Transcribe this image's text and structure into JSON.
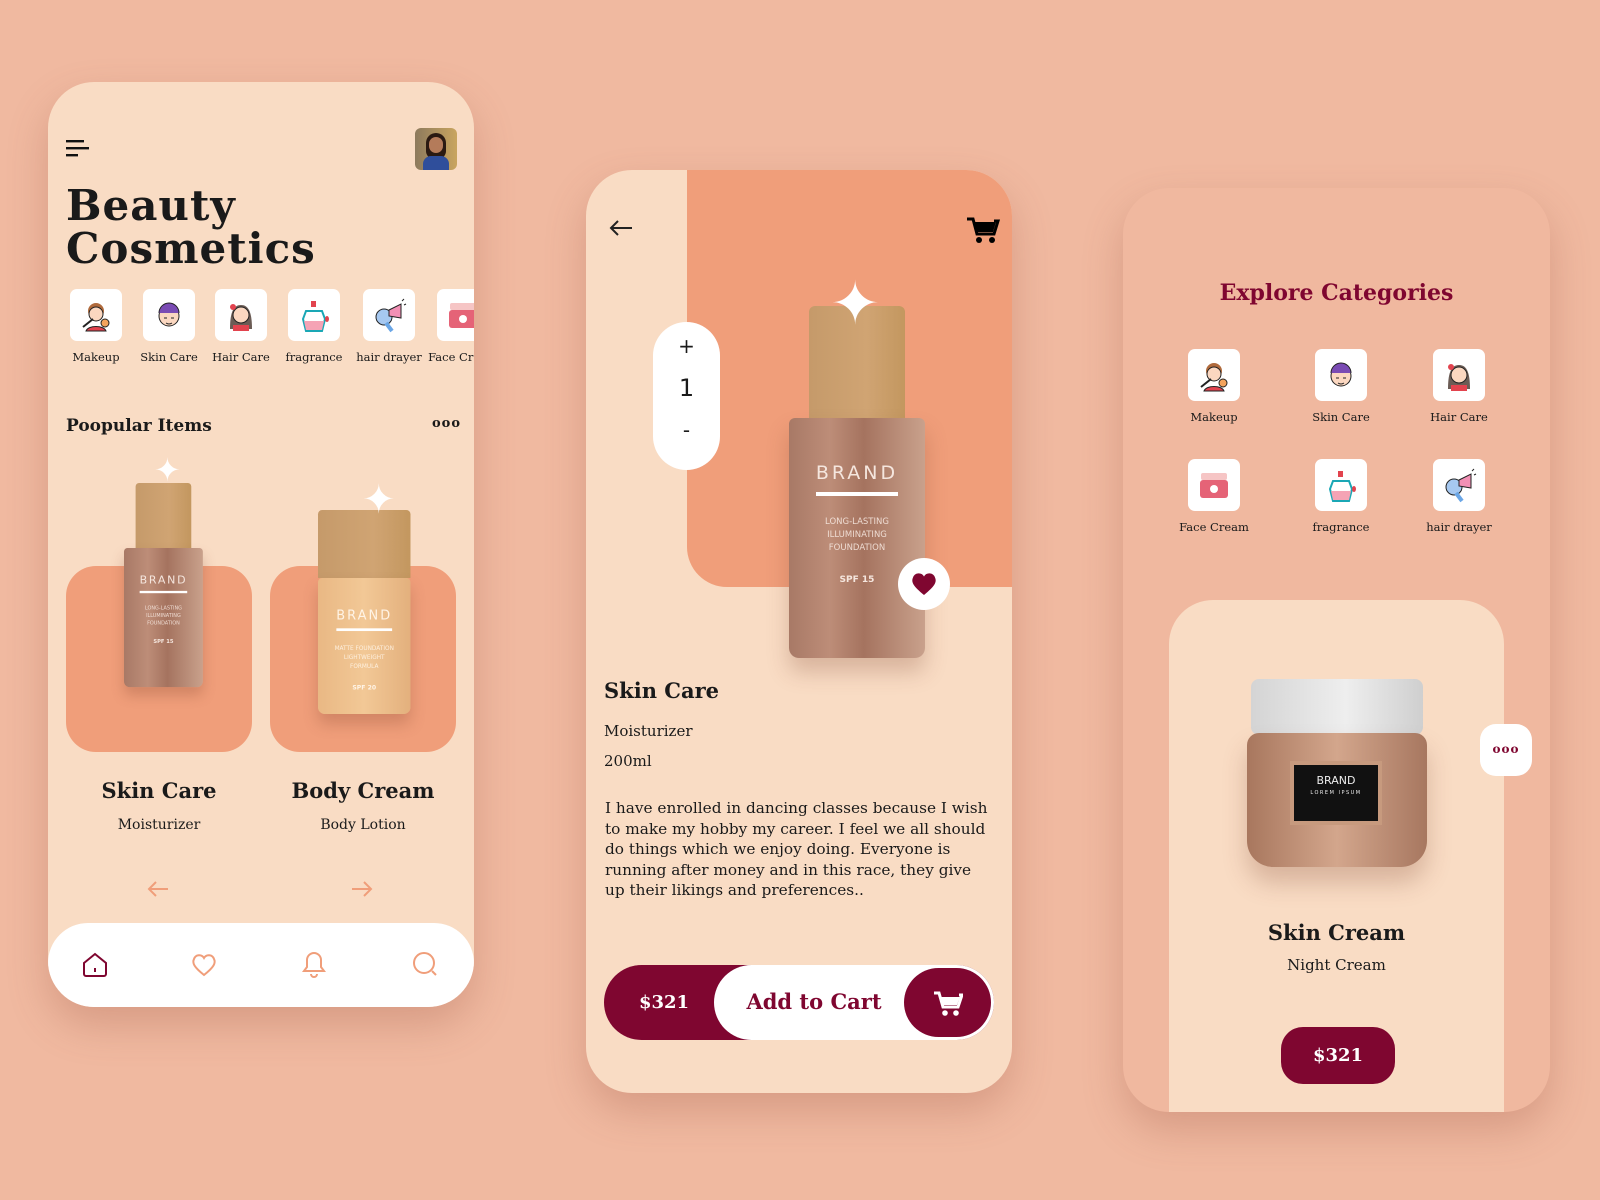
{
  "colors": {
    "background": "#f0b9a0",
    "card": "#f9dcc4",
    "accent": "#f09e7a",
    "brand": "#7f0630"
  },
  "home": {
    "title_line1": "Beauty",
    "title_line2": "Cosmetics",
    "categories": [
      {
        "label": "Makeup",
        "icon": "makeup-icon"
      },
      {
        "label": "Skin Care",
        "icon": "skin-care-icon"
      },
      {
        "label": "Hair Care",
        "icon": "hair-care-icon"
      },
      {
        "label": "fragrance",
        "icon": "fragrance-icon"
      },
      {
        "label": "hair drayer",
        "icon": "hair-dryer-icon"
      },
      {
        "label": "Face Cream",
        "icon": "face-cream-icon"
      }
    ],
    "section_title": "Poopular Items",
    "more": "ooo",
    "products": [
      {
        "title": "Skin Care",
        "subtitle": "Moisturizer",
        "brand": "BRAND",
        "desc": "LONG-LASTING\nILLUMINATING\nFOUNDATION",
        "spf": "SPF 15"
      },
      {
        "title": "Body Cream",
        "subtitle": "Body Lotion",
        "brand": "BRAND",
        "desc": "MATTE FOUNDATION\nLIGHTWEIGHT\nFORMULA",
        "spf": "SPF 20"
      }
    ],
    "nav": [
      "home-icon",
      "heart-icon",
      "bell-icon",
      "search-icon"
    ],
    "active_nav": "home"
  },
  "detail": {
    "quantity": "1",
    "plus": "+",
    "minus": "-",
    "product": {
      "brand": "BRAND",
      "desc": "LONG-LASTING\nILLUMINATING\nFOUNDATION",
      "spf": "SPF 15"
    },
    "title": "Skin Care",
    "subtitle": "Moisturizer",
    "size": "200ml",
    "description": "I have enrolled in dancing classes because I wish to make my hobby my career. I feel we all should do things which we enjoy doing. Everyone is running after money and in this race, they give up their likings and preferences..",
    "price": "$321",
    "add_to_cart": "Add to Cart",
    "favorited": true
  },
  "explore": {
    "title": "Explore Categories",
    "categories": [
      {
        "label": "Makeup",
        "icon": "makeup-icon"
      },
      {
        "label": "Skin Care",
        "icon": "skin-care-icon"
      },
      {
        "label": "Hair Care",
        "icon": "hair-care-icon"
      },
      {
        "label": "Face Cream",
        "icon": "face-cream-icon"
      },
      {
        "label": "fragrance",
        "icon": "fragrance-icon"
      },
      {
        "label": "hair drayer",
        "icon": "hair-dryer-icon"
      }
    ],
    "more": "ooo",
    "product": {
      "brand": "BRAND",
      "tagline": "LOREM IPSUM",
      "title": "Skin Cream",
      "subtitle": "Night Cream",
      "price": "$321"
    }
  }
}
